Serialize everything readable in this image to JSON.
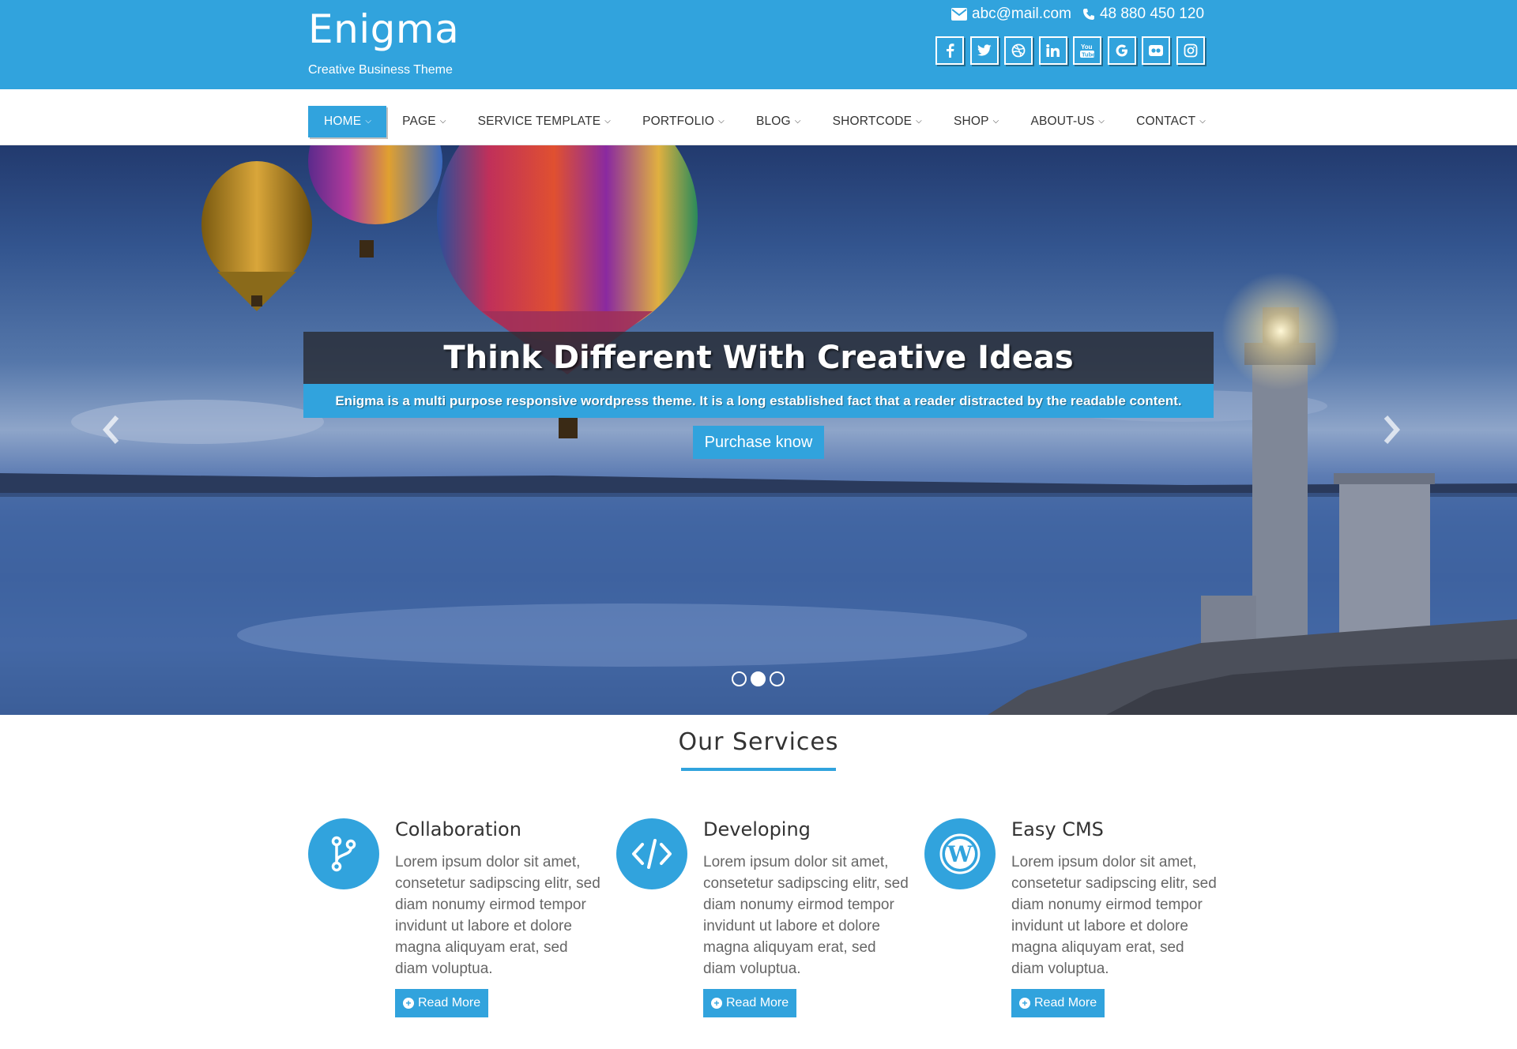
{
  "site": {
    "title": "Enigma",
    "tagline": "Creative Business Theme"
  },
  "contact": {
    "email": "abc@mail.com",
    "phone": "48 880 450 120"
  },
  "socials": [
    "facebook-icon",
    "twitter-icon",
    "dribbble-icon",
    "linkedin-icon",
    "youtube-icon",
    "google-icon",
    "flickr-icon",
    "instagram-icon"
  ],
  "nav": {
    "items": [
      {
        "label": "HOME",
        "active": true
      },
      {
        "label": "PAGE"
      },
      {
        "label": "SERVICE TEMPLATE"
      },
      {
        "label": "PORTFOLIO"
      },
      {
        "label": "BLOG"
      },
      {
        "label": "SHORTCODE"
      },
      {
        "label": "SHOP"
      },
      {
        "label": "ABOUT-US"
      },
      {
        "label": "CONTACT"
      }
    ]
  },
  "slider": {
    "title": "Think Different With Creative Ideas",
    "subtitle": "Enigma is a multi purpose responsive wordpress theme. It is a long established fact that a reader distracted by the readable content.",
    "button": "Purchase know",
    "slide_count": 3,
    "active_slide": 2
  },
  "services": {
    "heading": "Our Services",
    "items": [
      {
        "title": "Collaboration",
        "icon": "code-fork-icon",
        "text": "Lorem ipsum dolor sit amet, consetetur sadipscing elitr, sed diam nonumy eirmod tempor invidunt ut labore et dolore magna aliquyam erat, sed diam voluptua.",
        "button": "Read More"
      },
      {
        "title": "Developing",
        "icon": "code-icon",
        "text": "Lorem ipsum dolor sit amet, consetetur sadipscing elitr, sed diam nonumy eirmod tempor invidunt ut labore et dolore magna aliquyam erat, sed diam voluptua.",
        "button": "Read More"
      },
      {
        "title": "Easy CMS",
        "icon": "wordpress-icon",
        "text": "Lorem ipsum dolor sit amet, consetetur sadipscing elitr, sed diam nonumy eirmod tempor invidunt ut labore et dolore magna aliquyam erat, sed diam voluptua.",
        "button": "Read More"
      }
    ]
  },
  "colors": {
    "accent": "#31a3dd",
    "text": "#333333",
    "muted": "#666666"
  }
}
